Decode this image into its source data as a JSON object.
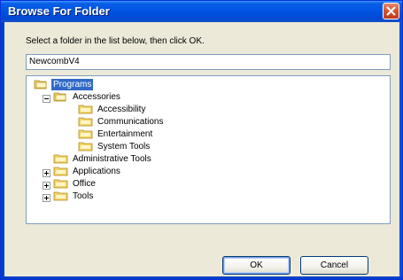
{
  "window": {
    "title": "Browse For Folder"
  },
  "dialog": {
    "prompt": "Select a folder in the list below, then click OK.",
    "path_value": "NewcombV4",
    "ok_label": "OK",
    "cancel_label": "Cancel"
  },
  "tree": {
    "items": [
      {
        "label": "Programs",
        "expanded": true,
        "selected": true,
        "icon": "folder-icon"
      },
      {
        "label": "Accessories",
        "expanded": true,
        "icon": "folder-icon"
      },
      {
        "label": "Accessibility",
        "icon": "folder-icon"
      },
      {
        "label": "Communications",
        "icon": "folder-icon"
      },
      {
        "label": "Entertainment",
        "icon": "folder-icon"
      },
      {
        "label": "System Tools",
        "icon": "folder-icon"
      },
      {
        "label": "Administrative Tools",
        "icon": "folder-icon"
      },
      {
        "label": "Applications",
        "expanded": false,
        "icon": "folder-icon"
      },
      {
        "label": "Office",
        "expanded": false,
        "icon": "folder-icon"
      },
      {
        "label": "Tools",
        "expanded": false,
        "icon": "folder-icon"
      }
    ]
  },
  "colors": {
    "title_bar": "#0053e1",
    "selection": "#316ac5",
    "dialog_face": "#ece9d8"
  }
}
